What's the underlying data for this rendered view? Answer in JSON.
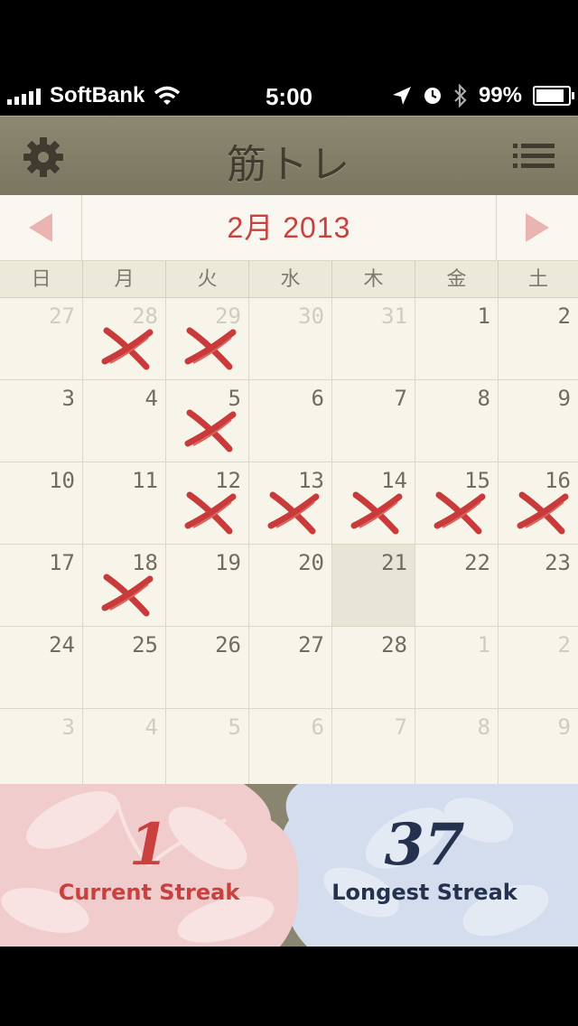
{
  "status": {
    "carrier": "SoftBank",
    "time": "5:00",
    "battery": "99%",
    "battery_level": 0.99
  },
  "nav": {
    "title": "筋トレ",
    "left_icon": "gear-icon",
    "right_icon": "list-icon"
  },
  "calendar": {
    "month_label": "2月 2013",
    "weekdays": [
      "日",
      "月",
      "火",
      "水",
      "木",
      "金",
      "土"
    ],
    "weeks": [
      [
        {
          "d": "27",
          "o": true
        },
        {
          "d": "28",
          "o": true,
          "x": true
        },
        {
          "d": "29",
          "o": true,
          "x": true
        },
        {
          "d": "30",
          "o": true
        },
        {
          "d": "31",
          "o": true
        },
        {
          "d": "1"
        },
        {
          "d": "2"
        }
      ],
      [
        {
          "d": "3"
        },
        {
          "d": "4"
        },
        {
          "d": "5",
          "x": true
        },
        {
          "d": "6"
        },
        {
          "d": "7"
        },
        {
          "d": "8"
        },
        {
          "d": "9"
        }
      ],
      [
        {
          "d": "10"
        },
        {
          "d": "11"
        },
        {
          "d": "12",
          "x": true
        },
        {
          "d": "13",
          "x": true
        },
        {
          "d": "14",
          "x": true
        },
        {
          "d": "15",
          "x": true
        },
        {
          "d": "16",
          "x": true
        }
      ],
      [
        {
          "d": "17"
        },
        {
          "d": "18",
          "x": true
        },
        {
          "d": "19"
        },
        {
          "d": "20"
        },
        {
          "d": "21",
          "today": true
        },
        {
          "d": "22"
        },
        {
          "d": "23"
        }
      ],
      [
        {
          "d": "24"
        },
        {
          "d": "25"
        },
        {
          "d": "26"
        },
        {
          "d": "27"
        },
        {
          "d": "28"
        },
        {
          "d": "1",
          "o": true
        },
        {
          "d": "2",
          "o": true
        }
      ],
      [
        {
          "d": "3",
          "o": true
        },
        {
          "d": "4",
          "o": true
        },
        {
          "d": "5",
          "o": true
        },
        {
          "d": "6",
          "o": true
        },
        {
          "d": "7",
          "o": true
        },
        {
          "d": "8",
          "o": true
        },
        {
          "d": "9",
          "o": true
        }
      ]
    ]
  },
  "streaks": {
    "current_value": "1",
    "current_label": "Current Streak",
    "longest_value": "37",
    "longest_label": "Longest Streak"
  },
  "colors": {
    "accent_red": "#c9403e",
    "navy": "#25324f",
    "nav_bg": "#847f69",
    "calendar_bg": "#f7f4ea"
  }
}
